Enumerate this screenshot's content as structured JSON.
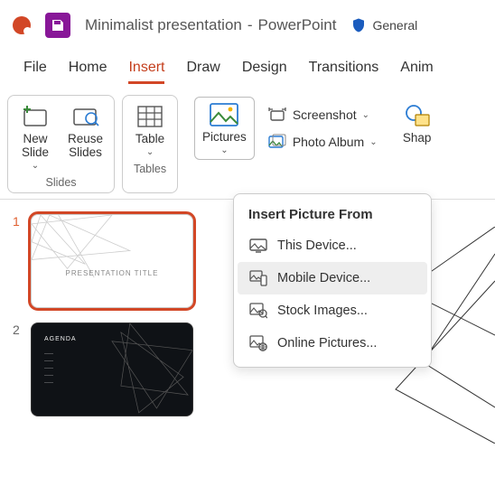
{
  "title": {
    "filename": "Minimalist presentation",
    "sep": " - ",
    "app": "PowerPoint",
    "sensitivity": "General"
  },
  "tabs": {
    "file": "File",
    "home": "Home",
    "insert": "Insert",
    "draw": "Draw",
    "design": "Design",
    "transitions": "Transitions",
    "animations": "Anim"
  },
  "ribbon": {
    "slides": {
      "new_slide": "New\nSlide",
      "reuse": "Reuse\nSlides",
      "label": "Slides"
    },
    "tables": {
      "table": "Table",
      "label": "Tables"
    },
    "images": {
      "pictures": "Pictures",
      "screenshot": "Screenshot",
      "photo_album": "Photo Album"
    },
    "shapes": {
      "shapes": "Shap"
    }
  },
  "dropdown": {
    "title": "Insert Picture From",
    "this_device": "This Device...",
    "mobile_device": "Mobile Device...",
    "stock_images": "Stock Images...",
    "online_pictures": "Online Pictures..."
  },
  "thumbs": {
    "s1": {
      "num": "1",
      "title": "PRESENTATION TITLE",
      "sub": ""
    },
    "s2": {
      "num": "2",
      "agenda": "AGENDA",
      "items": "——\n——\n——\n——\n——"
    }
  }
}
